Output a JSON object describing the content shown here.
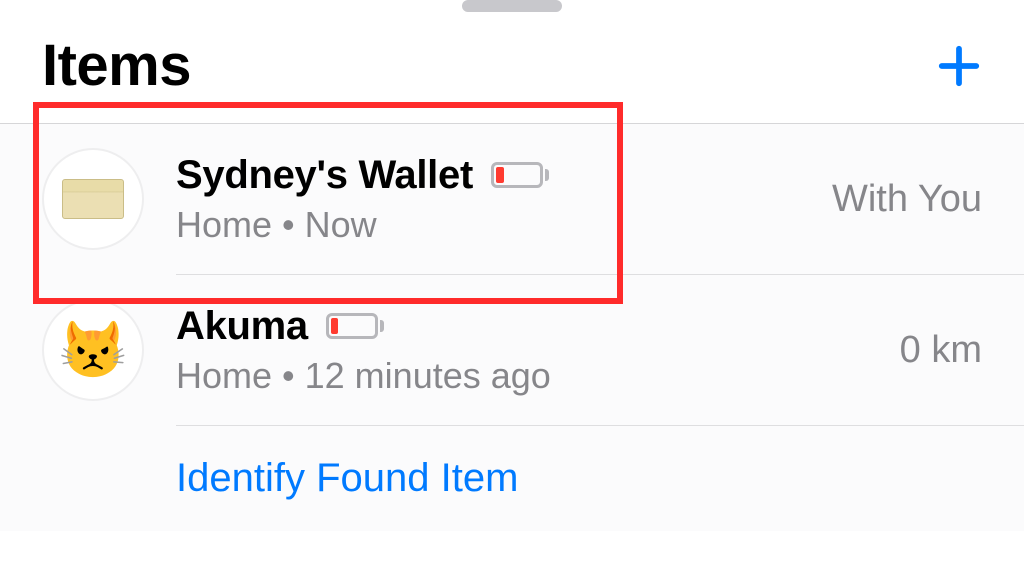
{
  "header": {
    "title": "Items"
  },
  "items": [
    {
      "name": "Sydney's Wallet",
      "location": "Home",
      "time": "Now",
      "trailing": "With You",
      "battery_fill_pct": 18,
      "icon_type": "card"
    },
    {
      "name": "Akuma",
      "location": "Home",
      "time": "12 minutes ago",
      "trailing": "0 km",
      "battery_fill_pct": 18,
      "icon_type": "emoji",
      "icon_emoji": "😾"
    }
  ],
  "identify": {
    "label": "Identify Found Item"
  },
  "colors": {
    "accent": "#007aff",
    "battery_low": "#ff3b30",
    "highlight": "#ff2b2b"
  }
}
